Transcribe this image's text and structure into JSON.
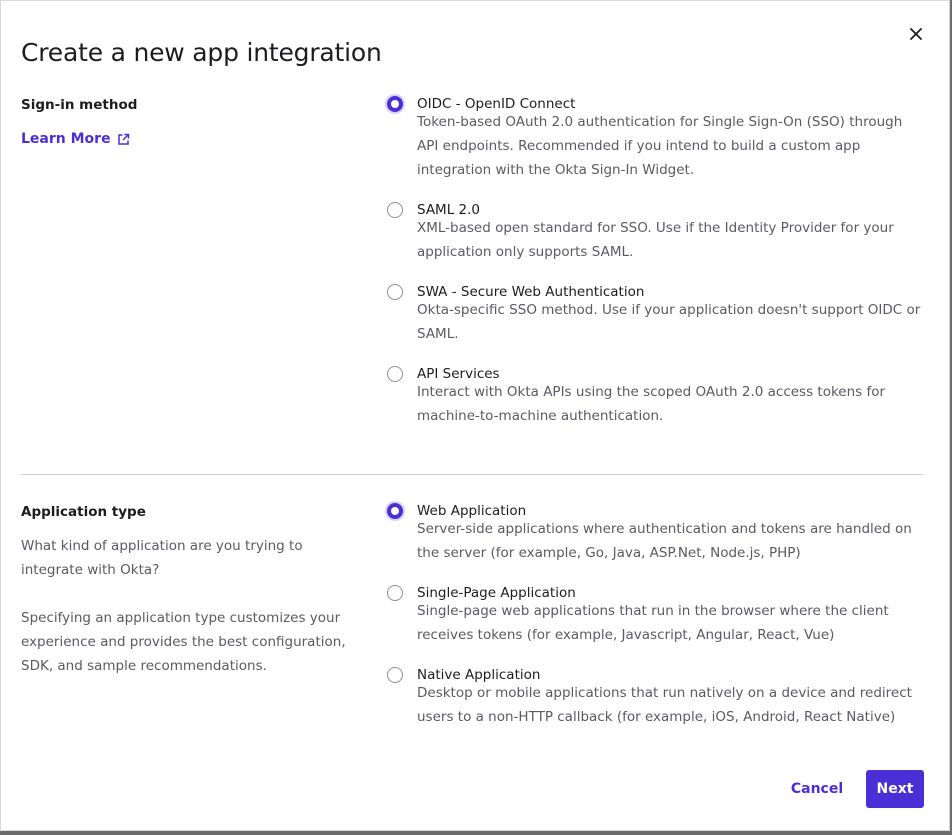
{
  "dialog": {
    "title": "Create a new app integration",
    "close_icon": "close-icon"
  },
  "sign_in": {
    "label": "Sign-in method",
    "learn_more": "Learn More",
    "learn_more_icon": "external-link-icon",
    "options": [
      {
        "label": "OIDC - OpenID Connect",
        "description": "Token-based OAuth 2.0 authentication for Single Sign-On (SSO) through API endpoints. Recommended if you intend to build a custom app integration with the Okta Sign-In Widget.",
        "selected": true
      },
      {
        "label": "SAML 2.0",
        "description": "XML-based open standard for SSO. Use if the Identity Provider for your application only supports SAML.",
        "selected": false
      },
      {
        "label": "SWA - Secure Web Authentication",
        "description": "Okta-specific SSO method. Use if your application doesn't support OIDC or SAML.",
        "selected": false
      },
      {
        "label": "API Services",
        "description": "Interact with Okta APIs using the scoped OAuth 2.0 access tokens for machine-to-machine authentication.",
        "selected": false
      }
    ]
  },
  "app_type": {
    "label": "Application type",
    "help_1": "What kind of application are you trying to integrate with Okta?",
    "help_2": "Specifying an application type customizes your experience and provides the best configuration, SDK, and sample recommendations.",
    "options": [
      {
        "label": "Web Application",
        "description": "Server-side applications where authentication and tokens are handled on the server (for example, Go, Java, ASP.Net, Node.js, PHP)",
        "selected": true
      },
      {
        "label": "Single-Page Application",
        "description": "Single-page web applications that run in the browser where the client receives tokens (for example, Javascript, Angular, React, Vue)",
        "selected": false
      },
      {
        "label": "Native Application",
        "description": "Desktop or mobile applications that run natively on a device and redirect users to a non-HTTP callback (for example, iOS, Android, React Native)",
        "selected": false
      }
    ]
  },
  "footer": {
    "cancel_label": "Cancel",
    "next_label": "Next"
  },
  "colors": {
    "accent": "#4b2fd6",
    "text": "#1d1d21",
    "muted": "#5a5a63"
  }
}
